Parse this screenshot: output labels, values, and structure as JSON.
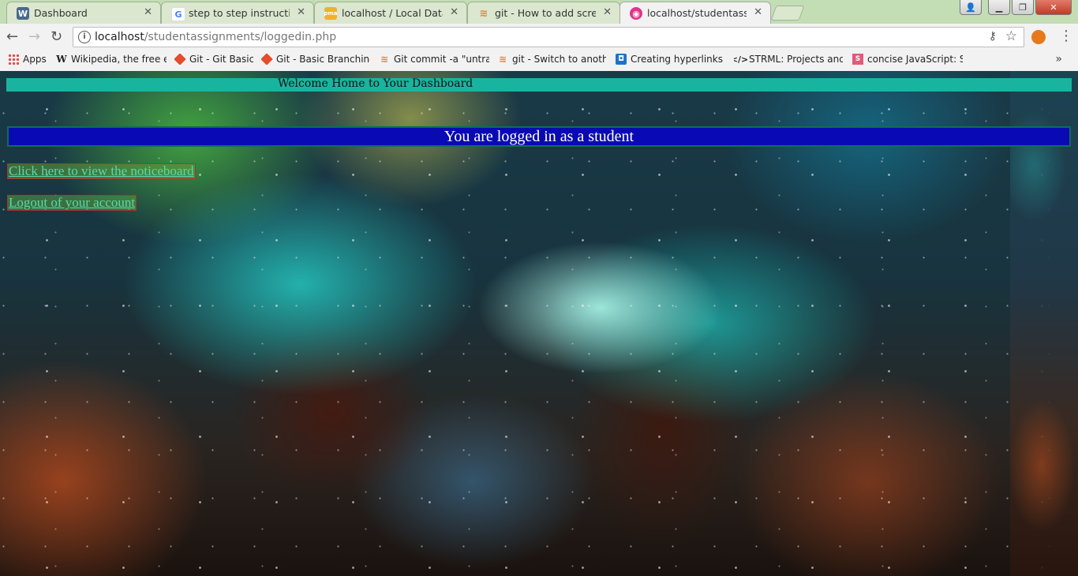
{
  "tabs": [
    {
      "title": "Dashboard",
      "icon": "wordpress-icon",
      "active": false
    },
    {
      "title": "step to step instructions",
      "icon": "google-icon",
      "active": false
    },
    {
      "title": "localhost / Local Databa",
      "icon": "phpmyadmin-icon",
      "active": false
    },
    {
      "title": "git - How to add screens",
      "icon": "stackoverflow-icon",
      "active": false
    },
    {
      "title": "localhost/studentassignm",
      "icon": "site-icon",
      "active": true
    }
  ],
  "address_bar": {
    "host": "localhost",
    "path": "/studentassignments/loggedin.php"
  },
  "bookmarks": [
    {
      "label": "Apps",
      "icon": "apps-icon"
    },
    {
      "label": "Wikipedia, the free en",
      "icon": "wikipedia-icon"
    },
    {
      "label": "Git - Git Basics",
      "icon": "git-icon"
    },
    {
      "label": "Git - Basic Branching a",
      "icon": "git-icon"
    },
    {
      "label": "Git commit -a \"untrac",
      "icon": "stackoverflow-icon"
    },
    {
      "label": "git - Switch to anothe",
      "icon": "stackoverflow-icon"
    },
    {
      "label": "Creating hyperlinks - L",
      "icon": "link-icon"
    },
    {
      "label": "STRML: Projects and V",
      "icon": "code-icon"
    },
    {
      "label": "concise JavaScript: Sli",
      "icon": "s-icon"
    }
  ],
  "page": {
    "welcome_text": "Welcome Home to Your Dashboard",
    "logged_in_text": "You are logged in as a student",
    "noticeboard_link": "Click here to view the noticeboard",
    "logout_link": "Logout of your account"
  },
  "colors": {
    "welcome_bar": "#19b4a0",
    "logged_bar": "#0a0ab4",
    "link_text": "#58d8b0"
  }
}
